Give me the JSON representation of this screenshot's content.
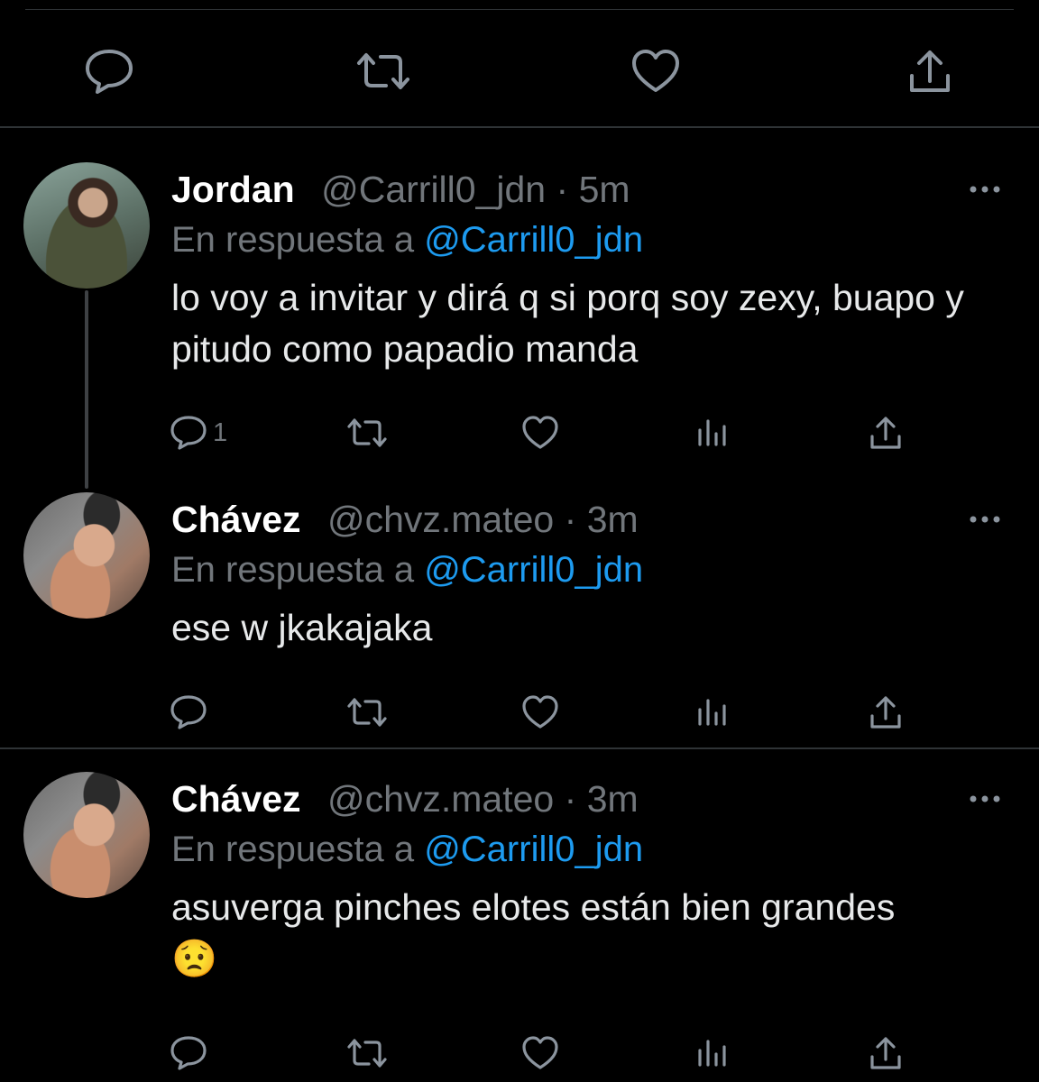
{
  "colors": {
    "background": "#000000",
    "text": "#e7e9ea",
    "muted": "#71767b",
    "link": "#1d9bf0",
    "divider": "#2f3336"
  },
  "top_actions": [
    "reply-icon",
    "retweet-icon",
    "like-icon",
    "share-icon"
  ],
  "tweets": [
    {
      "name": "Jordan",
      "handle": "@Carrill0_jdn",
      "dot": "·",
      "time": "5m",
      "reply_prefix": "En respuesta a",
      "reply_mention": "@Carrill0_jdn",
      "text": "lo voy a invitar y dirá q si porq soy zexy, buapo y pitudo como papadio manda",
      "reply_count": "1"
    },
    {
      "name": "Chávez",
      "handle": "@chvz.mateo",
      "dot": "·",
      "time": "3m",
      "reply_prefix": "En respuesta a",
      "reply_mention": "@Carrill0_jdn",
      "text": "ese w jkakajaka",
      "reply_count": ""
    },
    {
      "name": "Chávez",
      "handle": "@chvz.mateo",
      "dot": "·",
      "time": "3m",
      "reply_prefix": "En respuesta a",
      "reply_mention": "@Carrill0_jdn",
      "text": "asuverga pinches elotes están bien grandes 😟",
      "reply_count": ""
    }
  ]
}
